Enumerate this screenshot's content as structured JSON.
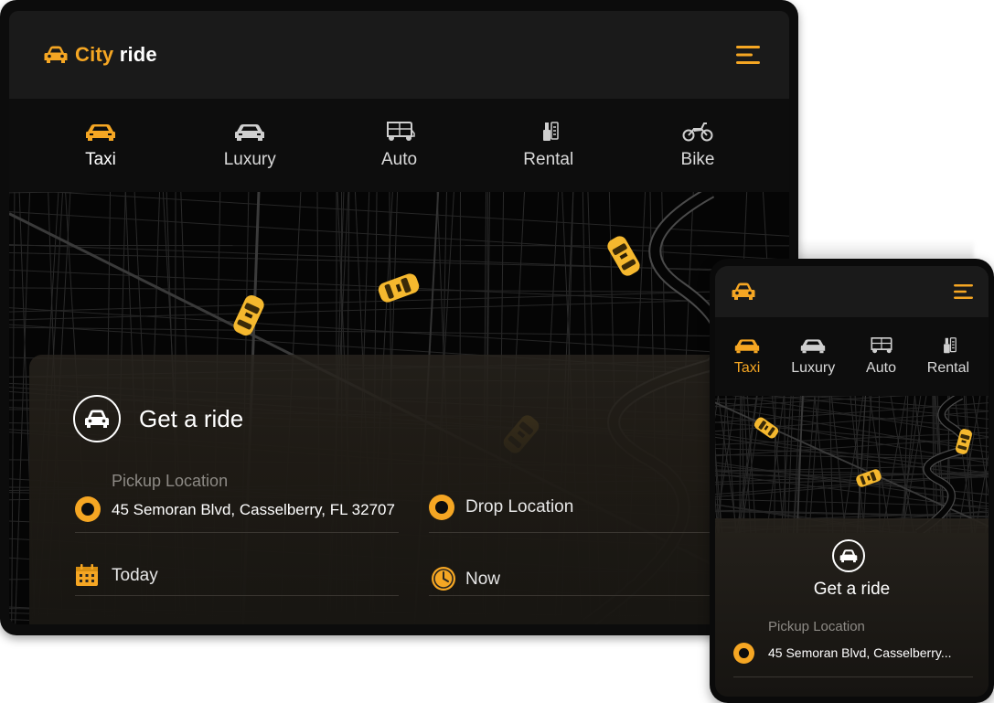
{
  "colors": {
    "accent": "#f5a623",
    "background": "#151515",
    "map": "#050505"
  },
  "tablet": {
    "header": {
      "logo_icon": "car-icon",
      "title_word1": "City",
      "title_word2": "ride",
      "menu_icon": "menu-icon"
    },
    "tabs": [
      {
        "label": "Taxi",
        "icon": "taxi-icon",
        "active": true
      },
      {
        "label": "Luxury",
        "icon": "luxury-car-icon",
        "active": false
      },
      {
        "label": "Auto",
        "icon": "auto-rickshaw-icon",
        "active": false
      },
      {
        "label": "Rental",
        "icon": "rental-icon",
        "active": false
      },
      {
        "label": "Bike",
        "icon": "motorbike-icon",
        "active": false
      }
    ],
    "panel": {
      "title": "Get a ride",
      "pickup": {
        "label": "Pickup Location",
        "value": "45 Semoran Blvd, Casselberry, FL 32707"
      },
      "drop": {
        "placeholder": "Drop Location"
      },
      "date": {
        "value": "Today",
        "icon": "calendar-icon"
      },
      "time": {
        "value": "Now",
        "icon": "clock-icon"
      }
    }
  },
  "phone": {
    "header": {
      "logo_icon": "car-icon",
      "menu_icon": "menu-icon"
    },
    "tabs": [
      {
        "label": "Taxi",
        "icon": "taxi-icon",
        "active": true
      },
      {
        "label": "Luxury",
        "icon": "luxury-car-icon",
        "active": false
      },
      {
        "label": "Auto",
        "icon": "auto-rickshaw-icon",
        "active": false
      },
      {
        "label": "Rental",
        "icon": "rental-icon",
        "active": false
      }
    ],
    "panel": {
      "title": "Get a ride",
      "pickup": {
        "label": "Pickup Location",
        "value": "45 Semoran Blvd, Casselberry..."
      }
    }
  }
}
